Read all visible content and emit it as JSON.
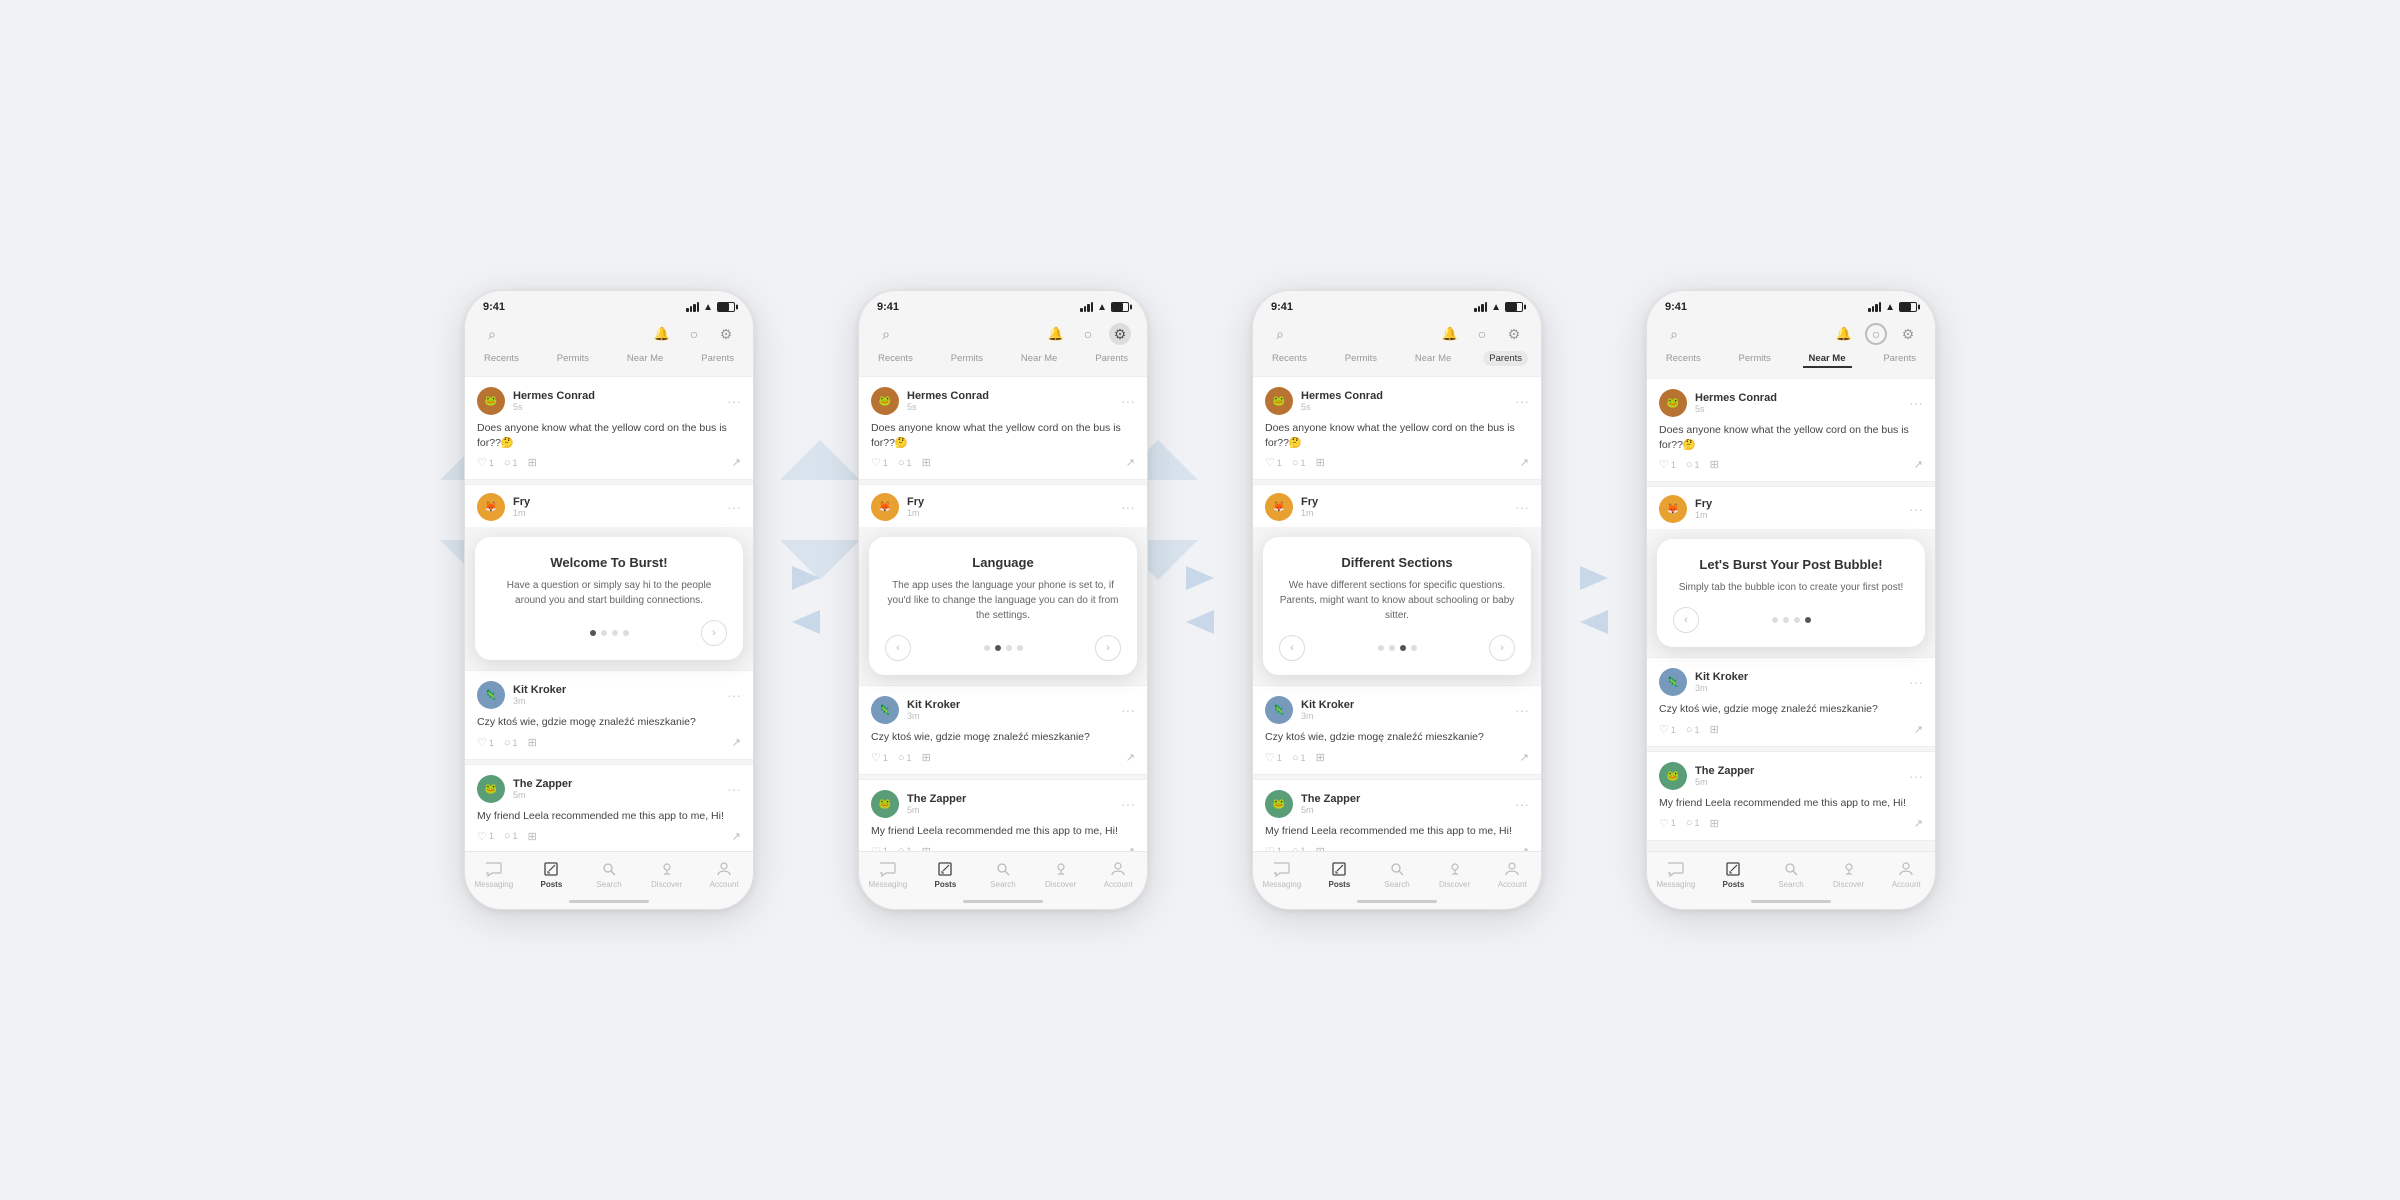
{
  "background": {
    "color": "#e8edf2"
  },
  "phones": [
    {
      "id": "phone-1",
      "status_time": "9:41",
      "active_tab": "none",
      "tabs": [
        "Recents",
        "Permits",
        "Near Me",
        "Parents"
      ],
      "onboarding": {
        "title": "Welcome To Burst!",
        "text": "Have a question or simply say hi to the people around you and start building connections.",
        "dot_active": 0,
        "show_left_arrow": false,
        "show_right_arrow": true
      },
      "posts": [
        {
          "user": "Hermes Conrad",
          "time": "5s",
          "avatar_type": "hermes",
          "text": "Does anyone know what the yellow cord on the bus is for??🤔"
        },
        {
          "user": "Fry",
          "time": "1m",
          "avatar_type": "fry",
          "text": ""
        },
        {
          "user": "Kit Kroker",
          "time": "3m",
          "avatar_type": "kif",
          "text": "Czy ktoś wie, gdzie mogę znaleźć mieszkanie?"
        },
        {
          "user": "The Zapper",
          "time": "5m",
          "avatar_type": "zapper",
          "text": "My friend Leela recommended me this app to me, Hi!"
        }
      ],
      "bottom_nav": [
        "Messaging",
        "Posts",
        "Search",
        "Discover",
        "Account"
      ],
      "active_bottom": "Posts",
      "active_filter": false,
      "active_circle": false
    },
    {
      "id": "phone-2",
      "status_time": "9:41",
      "active_tab": "none",
      "tabs": [
        "Recents",
        "Permits",
        "Near Me",
        "Parents"
      ],
      "onboarding": {
        "title": "Language",
        "text": "The app uses the language your phone is set to, if you'd like to change the language you can do it from the settings.",
        "dot_active": 1,
        "show_left_arrow": true,
        "show_right_arrow": true
      },
      "posts": [
        {
          "user": "Hermes Conrad",
          "time": "5s",
          "avatar_type": "hermes",
          "text": "Does anyone know what the yellow cord on the bus is for??🤔"
        },
        {
          "user": "Fry",
          "time": "1m",
          "avatar_type": "fry",
          "text": ""
        },
        {
          "user": "Kit Kroker",
          "time": "3m",
          "avatar_type": "kif",
          "text": "Czy ktoś wie, gdzie mogę znaleźć mieszkanie?"
        },
        {
          "user": "The Zapper",
          "time": "5m",
          "avatar_type": "zapper",
          "text": "My friend Leela recommended me this app to me, Hi!"
        }
      ],
      "bottom_nav": [
        "Messaging",
        "Posts",
        "Search",
        "Discover",
        "Account"
      ],
      "active_bottom": "Posts",
      "active_filter": true,
      "active_circle": false
    },
    {
      "id": "phone-3",
      "status_time": "9:41",
      "active_tab": "Parents",
      "tabs": [
        "Recents",
        "Permits",
        "Near Me",
        "Parents"
      ],
      "onboarding": {
        "title": "Different Sections",
        "text": "We have different sections for specific questions. Parents, might want to know about schooling or baby sitter.",
        "dot_active": 2,
        "show_left_arrow": true,
        "show_right_arrow": true
      },
      "posts": [
        {
          "user": "Hermes Conrad",
          "time": "5s",
          "avatar_type": "hermes",
          "text": "Does anyone know what the yellow cord on the bus is for??🤔"
        },
        {
          "user": "Fry",
          "time": "1m",
          "avatar_type": "fry",
          "text": ""
        },
        {
          "user": "Kit Kroker",
          "time": "3m",
          "avatar_type": "kif",
          "text": "Czy ktoś wie, gdzie mogę znaleźć mieszkanie?"
        },
        {
          "user": "The Zapper",
          "time": "5m",
          "avatar_type": "zapper",
          "text": "My friend Leela recommended me this app to me, Hi!"
        }
      ],
      "bottom_nav": [
        "Messaging",
        "Posts",
        "Search",
        "Discover",
        "Account"
      ],
      "active_bottom": "Posts",
      "active_filter": false,
      "active_circle": false
    },
    {
      "id": "phone-4",
      "status_time": "9:41",
      "active_tab": "Near Me",
      "tabs": [
        "Recents",
        "Permits",
        "Near Me",
        "Parents"
      ],
      "onboarding": {
        "title": "Let's Burst Your Post Bubble!",
        "text": "Simply tab the bubble icon to create your first post!",
        "dot_active": 3,
        "show_left_arrow": true,
        "show_right_arrow": false
      },
      "posts": [
        {
          "user": "Hermes Conrad",
          "time": "5s",
          "avatar_type": "hermes",
          "text": "Does anyone know what the yellow cord on the bus is for??🤔"
        },
        {
          "user": "Fry",
          "time": "1m",
          "avatar_type": "fry",
          "text": ""
        },
        {
          "user": "Kit Kroker",
          "time": "3m",
          "avatar_type": "kif",
          "text": "Czy ktoś wie, gdzie mogę znaleźć mieszkanie?"
        },
        {
          "user": "The Zapper",
          "time": "5m",
          "avatar_type": "zapper",
          "text": "My friend Leela recommended me this app to me, Hi!"
        }
      ],
      "bottom_nav": [
        "Messaging",
        "Posts",
        "Search",
        "Discover",
        "Account"
      ],
      "active_bottom": "Posts",
      "active_filter": false,
      "active_circle": true
    }
  ]
}
